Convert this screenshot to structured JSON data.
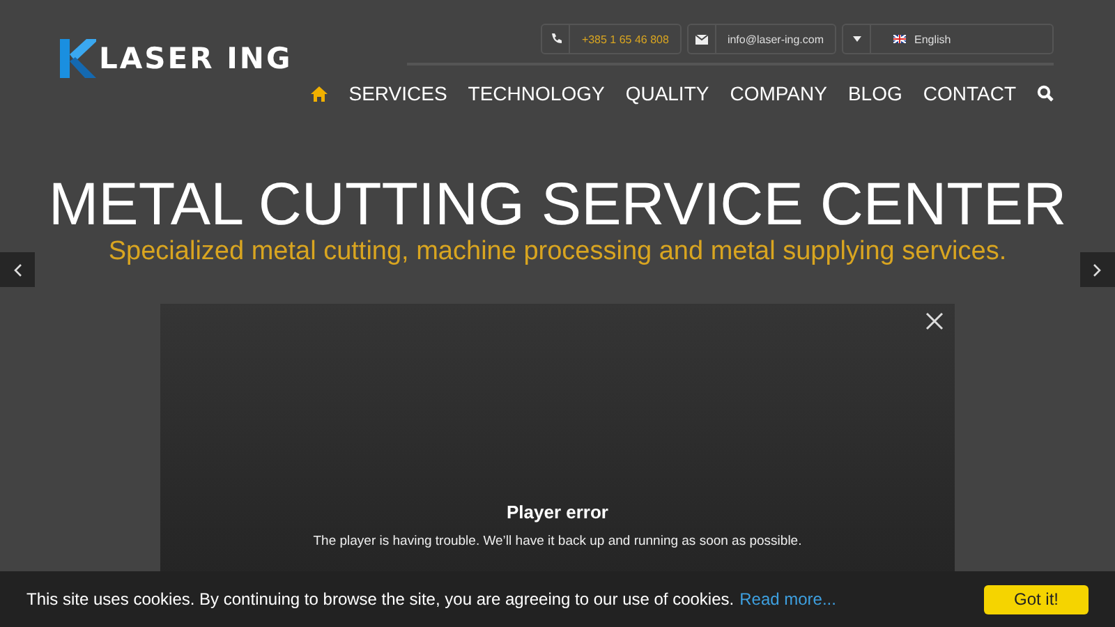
{
  "logo": {
    "text": "LASER ING"
  },
  "contact_bar": {
    "phone": "+385 1 65 46 808",
    "email": "info@laser-ing.com",
    "language": "English"
  },
  "nav": [
    {
      "kind": "home",
      "selected": true
    },
    {
      "kind": "link",
      "label": "SERVICES",
      "selected": false
    },
    {
      "kind": "link",
      "label": "TECHNOLOGY",
      "selected": false
    },
    {
      "kind": "link",
      "label": "QUALITY",
      "selected": false
    },
    {
      "kind": "link",
      "label": "COMPANY",
      "selected": false
    },
    {
      "kind": "link",
      "label": "BLOG",
      "selected": false
    },
    {
      "kind": "link",
      "label": "CONTACT",
      "selected": false
    },
    {
      "kind": "search",
      "selected": false
    }
  ],
  "hero": {
    "title": "METAL CUTTING SERVICE CENTER",
    "subtitle": "Specialized metal cutting, machine processing and metal supplying services."
  },
  "video": {
    "error_title": "Player error",
    "error_message": "The player is having trouble. We’ll have it back up and running as soon as possible."
  },
  "cookie_bar": {
    "message": "This site uses cookies. By continuing to browse the site, you are agreeing to our use of cookies.",
    "link": "Read more...",
    "button": "Got it!"
  }
}
